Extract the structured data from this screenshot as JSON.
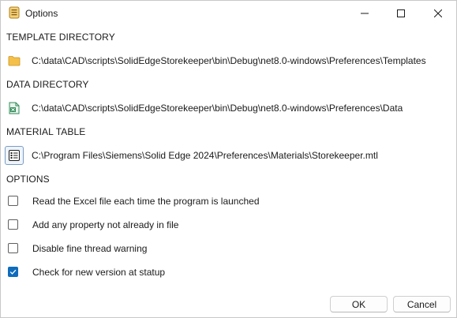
{
  "window": {
    "title": "Options"
  },
  "titlebar": {
    "app_icon": "preferences-app-icon",
    "min_icon": "minimize-icon",
    "max_icon": "maximize-icon",
    "close_icon": "close-icon"
  },
  "template_directory": {
    "heading": "TEMPLATE DIRECTORY",
    "icon": "folder-icon",
    "path": "C:\\data\\CAD\\scripts\\SolidEdgeStorekeeper\\bin\\Debug\\net8.0-windows\\Preferences\\Templates"
  },
  "data_directory": {
    "heading": "DATA DIRECTORY",
    "icon": "spreadsheet-icon",
    "path": "C:\\data\\CAD\\scripts\\SolidEdgeStorekeeper\\bin\\Debug\\net8.0-windows\\Preferences\\Data"
  },
  "material_table": {
    "heading": "MATERIAL TABLE",
    "icon": "list-icon",
    "path": "C:\\Program Files\\Siemens\\Solid Edge 2024\\Preferences\\Materials\\Storekeeper.mtl"
  },
  "options": {
    "heading": "OPTIONS",
    "items": [
      {
        "label": "Read the Excel file each time the program is launched",
        "checked": false
      },
      {
        "label": "Add any property not already in file",
        "checked": false
      },
      {
        "label": "Disable fine thread warning",
        "checked": false
      },
      {
        "label": "Check for new version at statup",
        "checked": true
      }
    ]
  },
  "footer": {
    "ok_label": "OK",
    "cancel_label": "Cancel"
  },
  "colors": {
    "accent": "#0f6cbd",
    "folder": "#f5c04a",
    "spreadsheet": "#2e8b57"
  }
}
